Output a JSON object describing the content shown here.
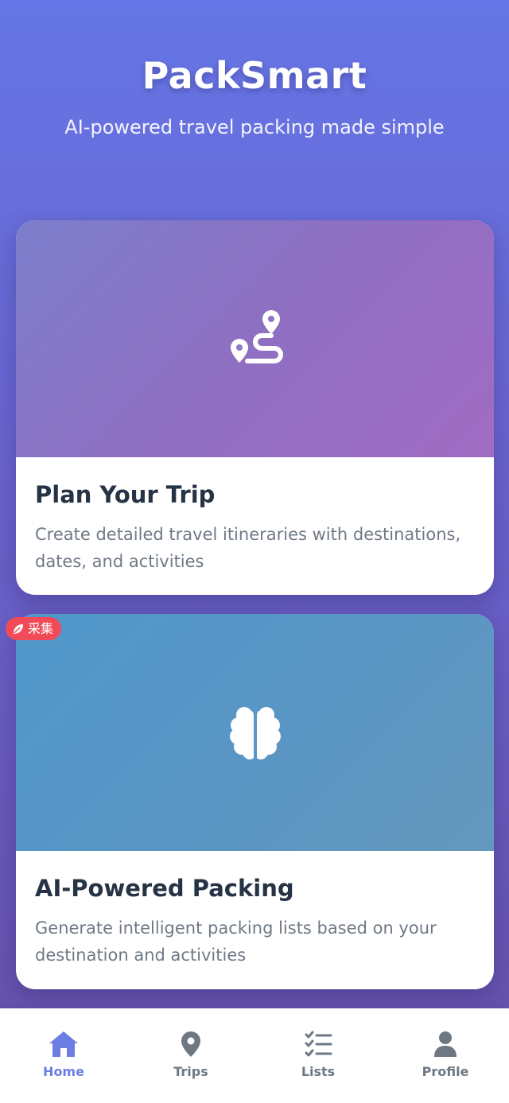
{
  "header": {
    "title": "PackSmart",
    "subtitle": "AI-powered travel packing made simple"
  },
  "cards": [
    {
      "title": "Plan Your Trip",
      "description": "Create detailed travel itineraries with destinations, dates, and activities",
      "icon": "route-icon"
    },
    {
      "title": "AI-Powered Packing",
      "description": "Generate intelligent packing lists based on your destination and activities",
      "icon": "brain-icon"
    }
  ],
  "badge": {
    "label": "采集",
    "icon": "leaf-icon"
  },
  "nav": {
    "items": [
      {
        "label": "Home",
        "icon": "home-icon",
        "active": true
      },
      {
        "label": "Trips",
        "icon": "location-pin-icon",
        "active": false
      },
      {
        "label": "Lists",
        "icon": "checklist-icon",
        "active": false
      },
      {
        "label": "Profile",
        "icon": "user-icon",
        "active": false
      }
    ]
  },
  "colors": {
    "accent": "#6d7ee2",
    "title_text": "#263345",
    "body_text": "#6f7985",
    "badge": "#f14b59"
  }
}
